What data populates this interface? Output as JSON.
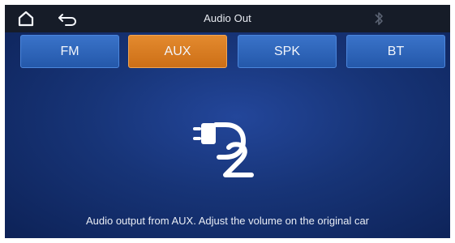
{
  "header": {
    "title": "Audio Out",
    "home_icon": "home-icon",
    "back_icon": "back-arrow-icon",
    "bluetooth_icon": "bluetooth-icon"
  },
  "tabs": [
    {
      "label": "FM",
      "active": false
    },
    {
      "label": "AUX",
      "active": true
    },
    {
      "label": "SPK",
      "active": false
    },
    {
      "label": "BT",
      "active": false
    }
  ],
  "main": {
    "icon": "aux-plug-logo-icon",
    "status": "Audio output from AUX. Adjust the volume on the original car"
  },
  "colors": {
    "accent_active": "#d97a22",
    "tab_blue": "#2e64b8",
    "background": "#173477",
    "topbar": "#161c28"
  }
}
